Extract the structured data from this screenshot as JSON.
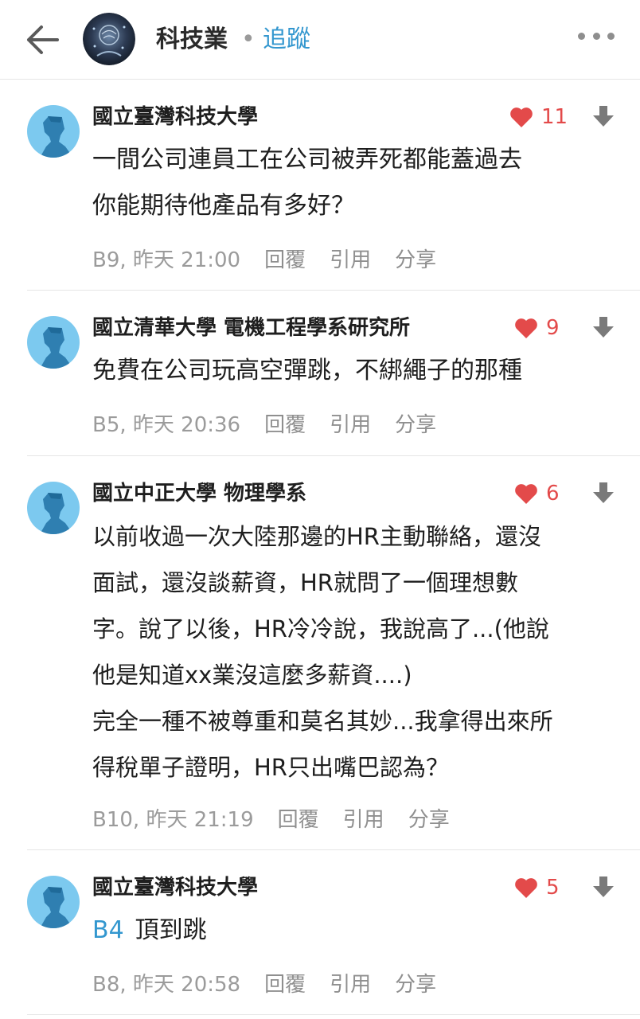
{
  "header": {
    "board_title": "科技業",
    "separator": "•",
    "follow_label": "追蹤"
  },
  "comments": [
    {
      "author": "國立臺灣科技大學",
      "likes": "11",
      "lines": [
        "一間公司連員工在公司被弄死都能蓋過去",
        "你能期待他產品有多好？"
      ],
      "floor_time": "B9, 昨天 21:00",
      "reply": "回覆",
      "quote": "引用",
      "share": "分享"
    },
    {
      "author": "國立清華大學 電機工程學系研究所",
      "likes": "9",
      "lines": [
        "免費在公司玩高空彈跳，不綁繩子的那種"
      ],
      "floor_time": "B5, 昨天 20:36",
      "reply": "回覆",
      "quote": "引用",
      "share": "分享"
    },
    {
      "author": "國立中正大學 物理學系",
      "likes": "6",
      "lines": [
        "以前收過一次大陸那邊的HR主動聯絡，還沒",
        "面試，還沒談薪資，HR就問了一個理想數",
        "字。說了以後，HR冷冷說，我說高了...(他說",
        "他是知道xx業沒這麼多薪資....)",
        "完全一種不被尊重和莫名其妙...我拿得出來所",
        "得稅單子證明，HR只出嘴巴認為？"
      ],
      "floor_time": "B10, 昨天 21:19",
      "reply": "回覆",
      "quote": "引用",
      "share": "分享"
    },
    {
      "author": "國立臺灣科技大學",
      "likes": "5",
      "quote_ref": "B4",
      "lines": [
        "頂到跳"
      ],
      "floor_time": "B8, 昨天 20:58",
      "reply": "回覆",
      "quote": "引用",
      "share": "分享"
    }
  ],
  "colors": {
    "accent": "#3397cf",
    "like": "#e34a4a",
    "avatar": "#7cc9ef",
    "avatar_figure": "#2f7fb1",
    "meta": "#9b9b9b"
  },
  "icons": {
    "back": "arrow-left-icon",
    "more": "more-dots-icon",
    "like": "heart-icon",
    "dislike": "arrow-down-icon",
    "avatar": "person-silhouette-icon"
  }
}
